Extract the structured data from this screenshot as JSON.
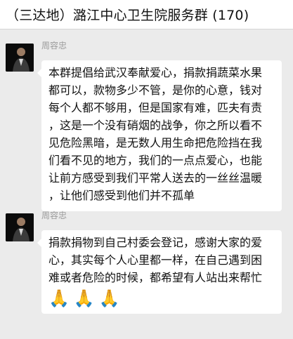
{
  "header": {
    "title": "（三达地）潞江中心卫生院服务群 (170)"
  },
  "messages": [
    {
      "sender": "周容忠",
      "lines": [
        "本群提倡给武汉奉献爱心，捐款捐蔬菜水果",
        "都可以，款物多少不管，是你的心意，钱对",
        "每个人都不够用，但是国家有难，匹夫有责",
        "，这是一个没有硝烟的战争，你之所以看不",
        "见危险黑暗，是无数人用生命把危险挡在我",
        "们看不见的地方，我们的一点点爱心，也能",
        "让前方感受到我们平常人送去的一丝丝温暖",
        "，让他们感受到他们并不孤单"
      ]
    },
    {
      "sender": "周容忠",
      "lines": [
        "捐款捐物到自己村委会登记，感谢大家的爱",
        "心，其实每个人心里都一样，在自己遇到困",
        "难或者危险的时候，都希望有人站出来帮忙"
      ],
      "emojis": [
        "🙏",
        "🙏",
        "🙏"
      ]
    }
  ]
}
